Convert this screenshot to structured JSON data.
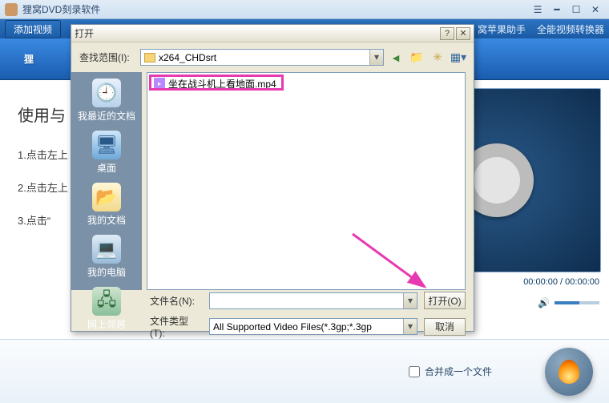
{
  "app": {
    "title": "狸窝DVD刻录软件"
  },
  "toolbar": {
    "add": "添加视频",
    "links": [
      "窝苹果助手",
      "全能视频转换器"
    ]
  },
  "banner": {
    "text": "狸"
  },
  "left": {
    "heading": "使用与",
    "step1": "1.点击左上",
    "step2": "2.点击左上",
    "step3": "3.点击“"
  },
  "preview": {
    "time": "00:00:00 / 00:00:00"
  },
  "controls": {
    "camera": "📷",
    "volume": "🔊"
  },
  "merge": {
    "label": "合并成一个文件"
  },
  "dialog": {
    "title": "打开",
    "lookin_label": "查找范围(I):",
    "folder": "x264_CHDsrt",
    "places": [
      "我最近的文档",
      "桌面",
      "我的文档",
      "我的电脑",
      "网上邻居"
    ],
    "file": "坐在战斗机上看地面.mp4",
    "filename_label": "文件名(N):",
    "filename_value": "",
    "filetype_label": "文件类型(T):",
    "filetype_value": "All Supported Video Files(*.3gp;*.3gp",
    "open_btn": "打开(O)",
    "cancel_btn": "取消"
  }
}
